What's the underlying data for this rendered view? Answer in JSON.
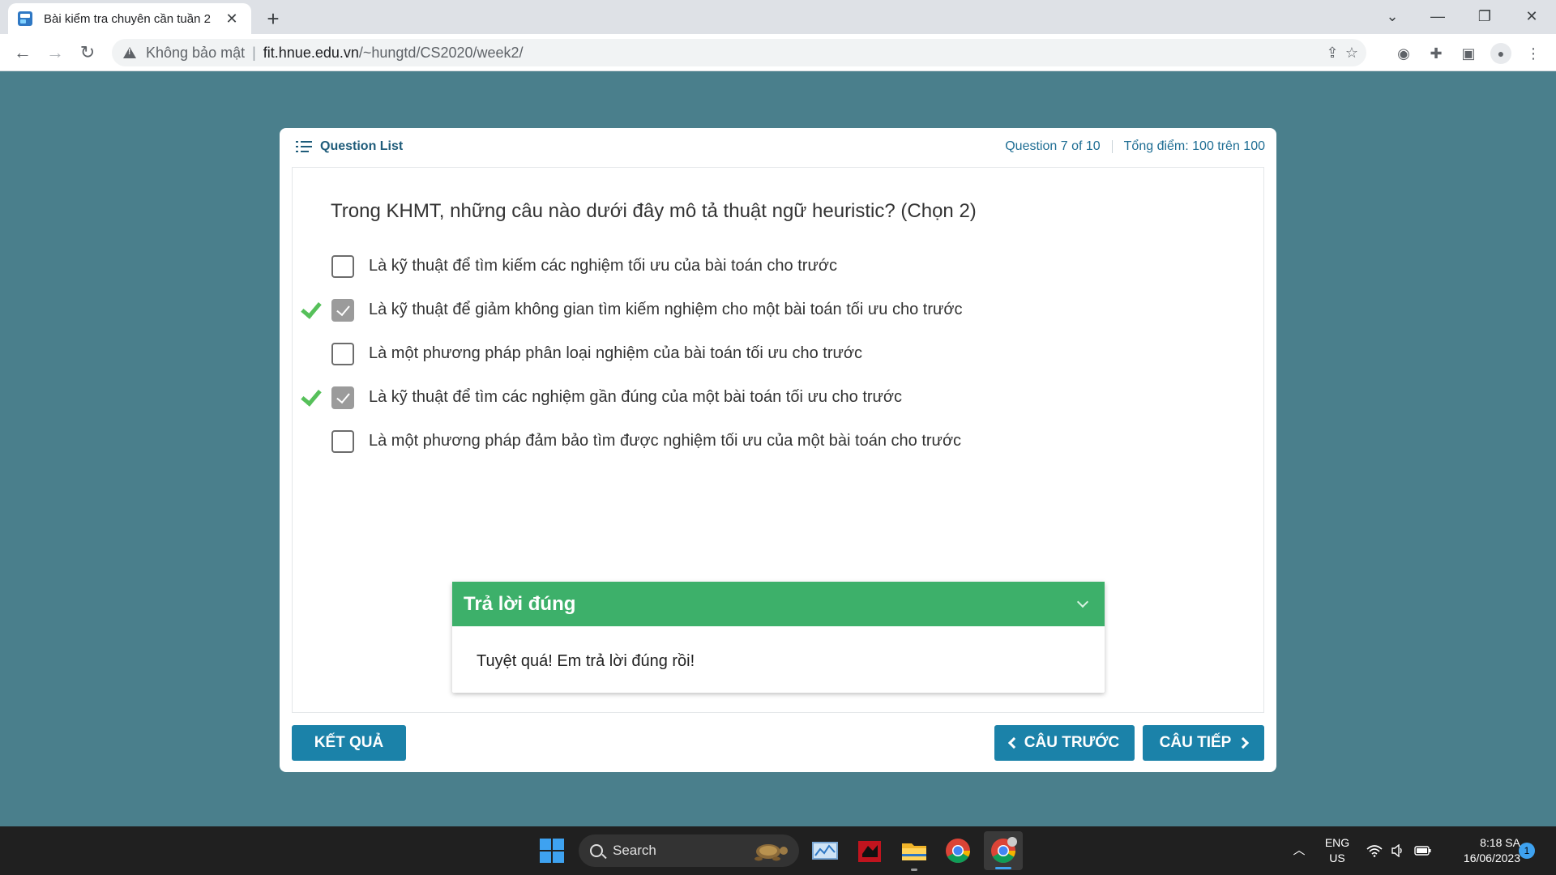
{
  "browser": {
    "tab": {
      "title": "Bài kiểm tra chuyên cần tuần 2",
      "close": "✕",
      "favicon": "page-favicon"
    },
    "new_tab": "+",
    "window": {
      "minimize": "—",
      "restore": "❐",
      "close": "✕",
      "tab_search": "⌄"
    },
    "address": {
      "security_label": "Không bảo mật",
      "separator": "|",
      "url_host": "fit.hnue.edu.vn",
      "url_path": "/~hungtd/CS2020/week2/"
    },
    "icons": [
      "back-icon",
      "forward-icon",
      "reload-icon",
      "share-icon",
      "star-icon",
      "camera-icon",
      "extensions-icon",
      "sidebar-icon",
      "profile-icon",
      "menu-icon"
    ]
  },
  "quiz": {
    "header": {
      "question_list": "Question List",
      "progress": "Question 7 of 10",
      "score": "Tổng điểm: 100 trên 100"
    },
    "question": "Trong KHMT, những câu nào dưới đây mô tả thuật ngữ heuristic? (Chọn 2)",
    "options": [
      {
        "label": "Là kỹ thuật để tìm kiếm các nghiệm tối ưu của bài toán cho trước",
        "checked": false,
        "correct": false
      },
      {
        "label": "Là kỹ thuật để giảm không gian tìm kiếm nghiệm cho một bài toán tối ưu cho trước",
        "checked": true,
        "correct": true
      },
      {
        "label": "Là một phương pháp phân loại nghiệm của bài toán tối ưu cho trước",
        "checked": false,
        "correct": false
      },
      {
        "label": "Là kỹ thuật để tìm các nghiệm gần đúng của một bài toán tối ưu cho trước",
        "checked": true,
        "correct": true
      },
      {
        "label": "Là một phương pháp đảm bảo tìm được nghiệm tối ưu của một bài toán cho trước",
        "checked": false,
        "correct": false
      }
    ],
    "feedback": {
      "title": "Trả lời đúng",
      "message": "Tuyệt quá! Em trả lời đúng rồi!"
    },
    "buttons": {
      "result": "KẾT QUẢ",
      "prev": "CÂU TRƯỚC",
      "next": "CÂU TIẾP"
    },
    "colors": {
      "background": "#4a7f8c",
      "accent": "#1b82a9",
      "correct": "#3db06a"
    }
  },
  "taskbar": {
    "search": "Search",
    "language": "ENG",
    "region": "US",
    "time": "8:18 SA",
    "date": "16/06/2023",
    "notifications": "1",
    "apps": [
      "windows-start-icon",
      "monitor-app-icon",
      "red-app-icon",
      "file-explorer-icon",
      "chrome-icon",
      "chrome-profile-icon"
    ]
  }
}
